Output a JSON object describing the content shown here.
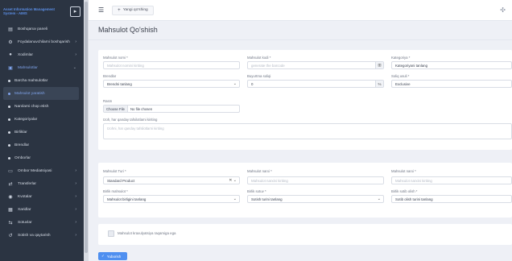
{
  "sidebar": {
    "brand": "Asset Information Management System - AIMS",
    "items": [
      {
        "label": "Boshqaruv paneli",
        "icon": "dashboard-icon",
        "glyph": "▤"
      },
      {
        "label": "Foydalanuvchilarni boshqarish",
        "icon": "users-gear-icon",
        "glyph": "⚙"
      },
      {
        "label": "Xodimlar",
        "icon": "user-icon",
        "glyph": "●"
      },
      {
        "label": "Mahsulotlar",
        "icon": "box-icon",
        "glyph": "▣"
      }
    ],
    "subitems": [
      {
        "label": "Barcha mahsulotlar"
      },
      {
        "label": "Mahsulot yaratish"
      },
      {
        "label": "Narxlarni chop etish"
      },
      {
        "label": "Kategoriyalar"
      },
      {
        "label": "Birliklar"
      },
      {
        "label": "Brendlar"
      },
      {
        "label": "Omborlar"
      }
    ],
    "items2": [
      {
        "label": "Ombor Mediatsiyasi",
        "icon": "warehouse-icon",
        "glyph": "▭"
      },
      {
        "label": "Transferlar",
        "icon": "transfer-icon",
        "glyph": "⇄"
      },
      {
        "label": "Kvotalar",
        "icon": "quote-icon",
        "glyph": "◉"
      },
      {
        "label": "Xaridlar",
        "icon": "cart-icon",
        "glyph": "▦"
      },
      {
        "label": "Sotuvlar",
        "icon": "sales-icon",
        "glyph": "⇆"
      },
      {
        "label": "Sotish va qaytarish",
        "icon": "return-icon",
        "glyph": "↺"
      }
    ]
  },
  "topbar": {
    "new_order": "Yangi qo'shing"
  },
  "page": {
    "title": "Mahsulot Qo'shish"
  },
  "form": {
    "name_label": "Mahsulot nomi *",
    "name_placeholder": "Mahsulot nomini kiriting",
    "code_label": "Mahsulot kodi *",
    "code_placeholder": "generate the barcode",
    "category_label": "Kategoriya *",
    "category_value": "Kategoriyani tanlang",
    "brand_label": "Brendlar",
    "brand_value": "Brendni tanlang",
    "discount_label": "Buyurtma soliqi",
    "discount_value": "0",
    "discount_suffix": "%",
    "tax_label": "Soliq usuli *",
    "tax_value": "Exclusive",
    "image_label": "Rasm",
    "choose_file": "Choose File",
    "no_file": "No file chosen",
    "desc_label": "Izoh, har qanday tafsilotlarni kiriting",
    "desc_placeholder": "Izohni, har qanday tafsilotlarni kiriting",
    "type_label": "Mahsulot Turi *",
    "type_value": "Standard Product",
    "cost_label": "Mahsulot narxi *",
    "cost_placeholder": "Mahsulot narxini kiriting",
    "price_label": "Mahsulot narxi *",
    "price_placeholder": "Mahsulot narxini kiriting",
    "unit_label": "Birlik mahsulot *",
    "unit_value": "Mahsulot birligini tanlang",
    "sale_unit_label": "Birlik sotuv *",
    "sale_unit_value": "Sotish turini tanlang",
    "purchase_unit_label": "Birlik sotib olish *",
    "purchase_unit_value": "Sotib olish turini tanlang",
    "checkbox_label": "Mahsulot kraxulyatsiya raqamiga ega",
    "save": "Yuborish"
  },
  "colors": {
    "sidebar_bg": "#2b3442",
    "accent": "#4f8ff0",
    "page_bg": "#eef0f6"
  }
}
